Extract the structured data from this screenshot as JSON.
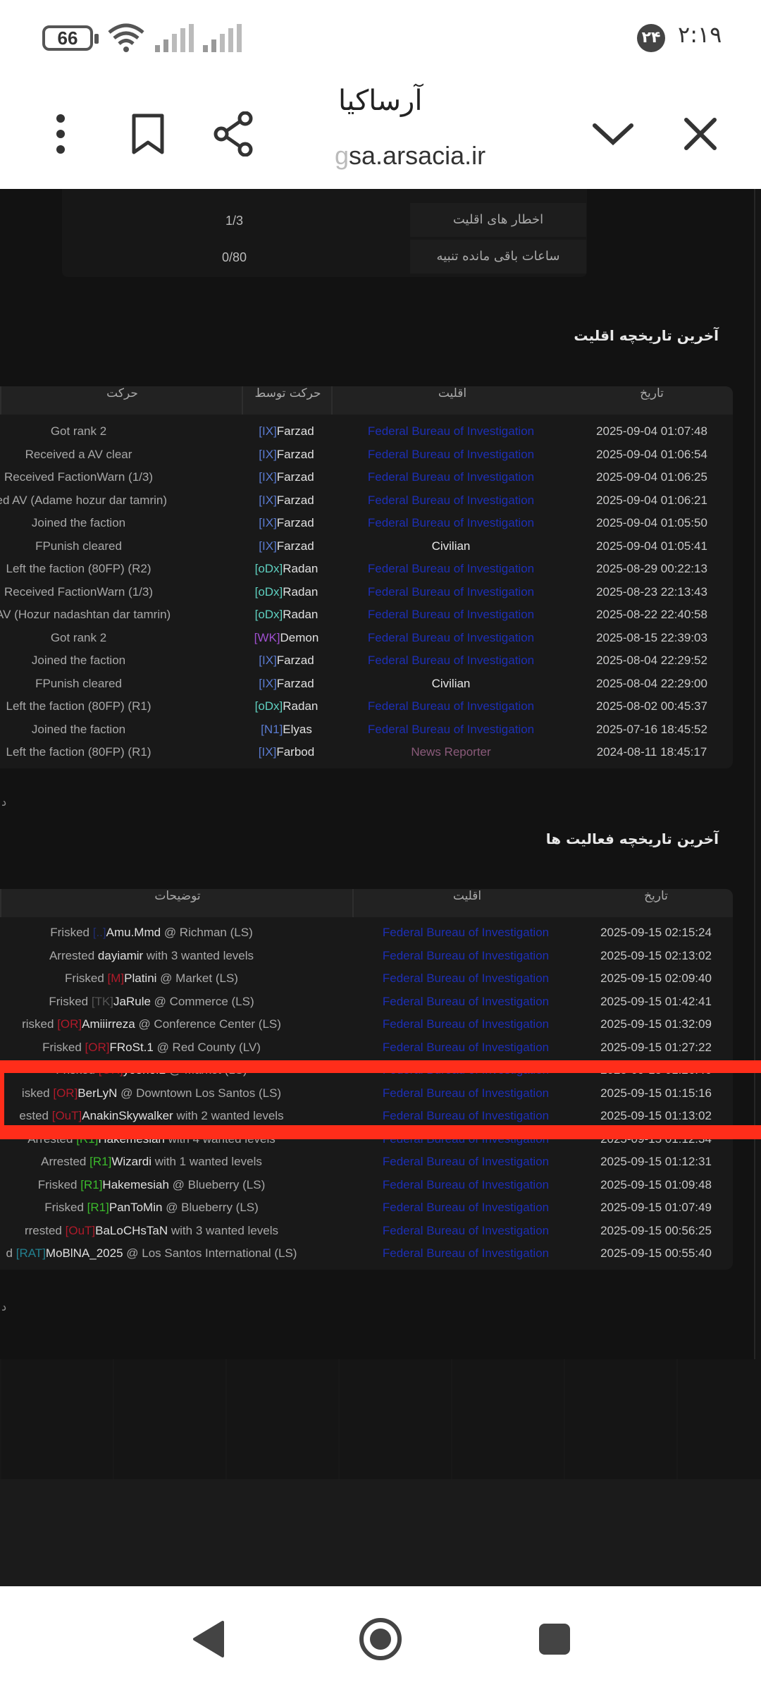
{
  "status_bar": {
    "battery": "66",
    "badge": "۲۴",
    "time": "۲:۱۹"
  },
  "browser": {
    "title": "آرساکیا",
    "url_faded": "g",
    "url": "sa.arsacia.ir"
  },
  "summary": {
    "rows": [
      {
        "label": "اخطار های اقلیت",
        "value": "1/3"
      },
      {
        "label": "ساعات باقی مانده تنبیه",
        "value": "0/80"
      }
    ]
  },
  "history": {
    "title": "آخرین تاریخچه اقلیت",
    "headers": {
      "date": "تاریخ",
      "faction": "اقلیت",
      "by": "حرکت توسط",
      "action": "حرکت"
    },
    "more": "د",
    "rows": [
      {
        "date": "2025-09-04 01:07:48",
        "faction": "Federal Bureau of Investigation",
        "ftype": "fbi",
        "tag": "[IX]",
        "tagc": "tag",
        "by": "Farzad",
        "action": "Got rank 2"
      },
      {
        "date": "2025-09-04 01:06:54",
        "faction": "Federal Bureau of Investigation",
        "ftype": "fbi",
        "tag": "[IX]",
        "tagc": "tag",
        "by": "Farzad",
        "action": "Received a AV clear"
      },
      {
        "date": "2025-09-04 01:06:25",
        "faction": "Federal Bureau of Investigation",
        "ftype": "fbi",
        "tag": "[IX]",
        "tagc": "tag",
        "by": "Farzad",
        "action": "Received FactionWarn (1/3)"
      },
      {
        "date": "2025-09-04 01:06:21",
        "faction": "Federal Bureau of Investigation",
        "ftype": "fbi",
        "tag": "[IX]",
        "tagc": "tag",
        "by": "Farzad",
        "action": "ved AV (Adame hozur dar tamrin)"
      },
      {
        "date": "2025-09-04 01:05:50",
        "faction": "Federal Bureau of Investigation",
        "ftype": "fbi",
        "tag": "[IX]",
        "tagc": "tag",
        "by": "Farzad",
        "action": "Joined the faction"
      },
      {
        "date": "2025-09-04 01:05:41",
        "faction": "Civilian",
        "ftype": "civ",
        "tag": "[IX]",
        "tagc": "tag",
        "by": "Farzad",
        "action": "FPunish cleared"
      },
      {
        "date": "2025-08-29 00:22:13",
        "faction": "Federal Bureau of Investigation",
        "ftype": "fbi",
        "tag": "[oDx]",
        "tagc": "tag-odx",
        "by": "Radan",
        "action": "Left the faction (80FP) (R2)"
      },
      {
        "date": "2025-08-23 22:13:43",
        "faction": "Federal Bureau of Investigation",
        "ftype": "fbi",
        "tag": "[oDx]",
        "tagc": "tag-odx",
        "by": "Radan",
        "action": "Received FactionWarn (1/3)"
      },
      {
        "date": "2025-08-22 22:40:58",
        "faction": "Federal Bureau of Investigation",
        "ftype": "fbi",
        "tag": "[oDx]",
        "tagc": "tag-odx",
        "by": "Radan",
        "action": "d AV (Hozur nadashtan dar tamrin)"
      },
      {
        "date": "2025-08-15 22:39:03",
        "faction": "Federal Bureau of Investigation",
        "ftype": "fbi",
        "tag": "[WK]",
        "tagc": "tag-wk",
        "by": "Demon",
        "action": "Got rank 2"
      },
      {
        "date": "2025-08-04 22:29:52",
        "faction": "Federal Bureau of Investigation",
        "ftype": "fbi",
        "tag": "[IX]",
        "tagc": "tag",
        "by": "Farzad",
        "action": "Joined the faction"
      },
      {
        "date": "2025-08-04 22:29:00",
        "faction": "Civilian",
        "ftype": "civ",
        "tag": "[IX]",
        "tagc": "tag",
        "by": "Farzad",
        "action": "FPunish cleared"
      },
      {
        "date": "2025-08-02 00:45:37",
        "faction": "Federal Bureau of Investigation",
        "ftype": "fbi",
        "tag": "[oDx]",
        "tagc": "tag-odx",
        "by": "Radan",
        "action": "Left the faction (80FP) (R1)"
      },
      {
        "date": "2025-07-16 18:45:52",
        "faction": "Federal Bureau of Investigation",
        "ftype": "fbi",
        "tag": "[N1]",
        "tagc": "tag-n1",
        "by": "Elyas",
        "action": "Joined the faction"
      },
      {
        "date": "2024-08-11 18:45:17",
        "faction": "News Reporter",
        "ftype": "news",
        "tag": "[IX]",
        "tagc": "tag",
        "by": "Farbod",
        "action": "Left the faction (80FP) (R1)"
      }
    ]
  },
  "activity": {
    "title": "آخرین تاریخچه فعالیت ها",
    "headers": {
      "date": "تاریخ",
      "faction": "اقلیت",
      "desc": "توضیحات"
    },
    "more": "د",
    "rows": [
      {
        "date": "2025-09-15 02:15:24",
        "faction": "Federal Bureau of Investigation",
        "pre": "Frisked",
        "tag": "[..]",
        "tagc": "mark-blue",
        "name": "Amu.Mmd",
        "post": "@ Richman (LS)"
      },
      {
        "date": "2025-09-15 02:13:02",
        "faction": "Federal Bureau of Investigation",
        "pre": "Arrested",
        "tag": "",
        "tagc": "",
        "name": "dayiamir",
        "post": "with 3 wanted levels"
      },
      {
        "date": "2025-09-15 02:09:40",
        "faction": "Federal Bureau of Investigation",
        "pre": "Frisked",
        "tag": "[M]",
        "tagc": "mark-red",
        "name": "Platini",
        "post": "@ Market (LS)"
      },
      {
        "date": "2025-09-15 01:42:41",
        "faction": "Federal Bureau of Investigation",
        "pre": "Frisked",
        "tag": "[TK]",
        "tagc": "mark-gray",
        "name": "JaRule",
        "post": "@ Commerce (LS)"
      },
      {
        "date": "2025-09-15 01:32:09",
        "faction": "Federal Bureau of Investigation",
        "pre": "risked",
        "tag": "[OR]",
        "tagc": "mark-red",
        "name": "Amiiirreza",
        "post": "@ Conference Center (LS)"
      },
      {
        "date": "2025-09-15 01:27:22",
        "faction": "Federal Bureau of Investigation",
        "pre": "Frisked",
        "tag": "[OR]",
        "tagc": "mark-red",
        "name": "FRoSt.1",
        "post": "@ Red County (LV)"
      },
      {
        "date": "2025-09-15 01:26:46",
        "faction": "Federal Bureau of Investigation",
        "pre": "Frisked",
        "tag": "[OR]",
        "tagc": "mark-red",
        "name": "yo3hef2",
        "post": "@ Market (LS)"
      },
      {
        "date": "2025-09-15 01:15:16",
        "faction": "Federal Bureau of Investigation",
        "pre": "isked",
        "tag": "[OR]",
        "tagc": "mark-red",
        "name": "BerLyN",
        "post": "@ Downtown Los Santos (LS)"
      },
      {
        "date": "2025-09-15 01:13:02",
        "faction": "Federal Bureau of Investigation",
        "pre": "ested",
        "tag": "[OuT]",
        "tagc": "mark-red",
        "name": "AnakinSkywalker",
        "post": "with 2 wanted levels"
      },
      {
        "date": "2025-09-15 01:12:34",
        "faction": "Federal Bureau of Investigation",
        "pre": "Arrested",
        "tag": "[R1]",
        "tagc": "mark-green",
        "name": "Hakemesiah",
        "post": "with 4 wanted levels"
      },
      {
        "date": "2025-09-15 01:12:31",
        "faction": "Federal Bureau of Investigation",
        "pre": "Arrested",
        "tag": "[R1]",
        "tagc": "mark-green",
        "name": "Wizardi",
        "post": "with 1 wanted levels"
      },
      {
        "date": "2025-09-15 01:09:48",
        "faction": "Federal Bureau of Investigation",
        "pre": "Frisked",
        "tag": "[R1]",
        "tagc": "mark-green",
        "name": "Hakemesiah",
        "post": "@ Blueberry (LS)"
      },
      {
        "date": "2025-09-15 01:07:49",
        "faction": "Federal Bureau of Investigation",
        "pre": "Frisked",
        "tag": "[R1]",
        "tagc": "mark-green",
        "name": "PanToMin",
        "post": "@ Blueberry (LS)"
      },
      {
        "date": "2025-09-15 00:56:25",
        "faction": "Federal Bureau of Investigation",
        "pre": "rrested",
        "tag": "[OuT]",
        "tagc": "mark-red",
        "name": "BaLoCHsTaN",
        "post": "with 3 wanted levels"
      },
      {
        "date": "2025-09-15 00:55:40",
        "faction": "Federal Bureau of Investigation",
        "pre": "d",
        "tag": "[RAT]",
        "tagc": "mark-cyan",
        "name": "MoBlNA_2025",
        "post": "@ Los Santos International (LS)"
      }
    ]
  }
}
